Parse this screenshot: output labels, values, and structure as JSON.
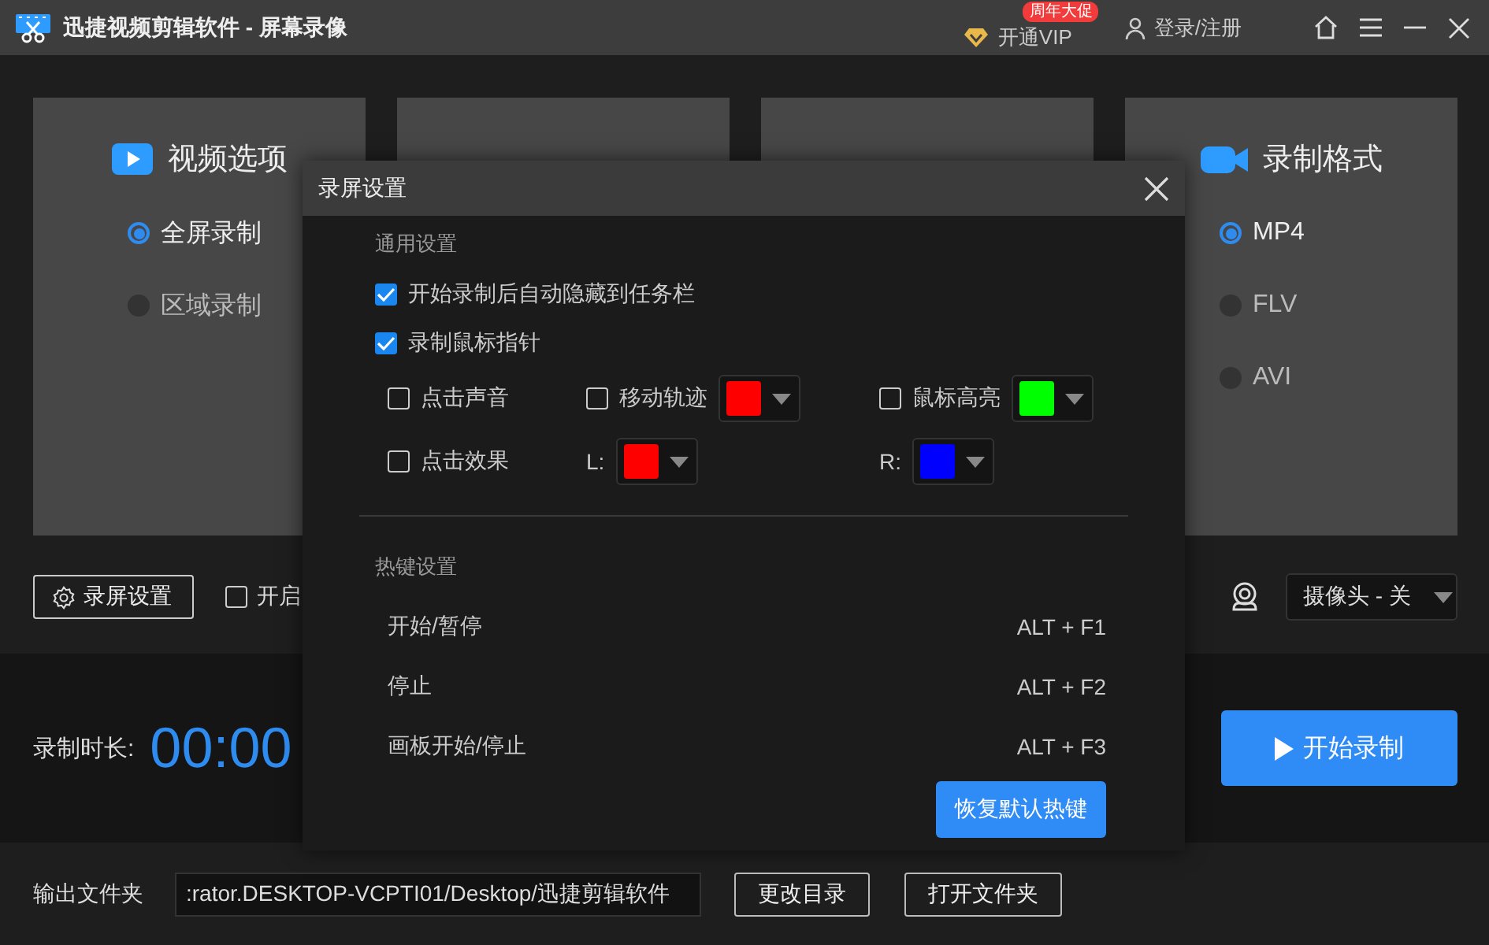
{
  "title_bar": {
    "app_name": "迅捷视频剪辑软件 - 屏幕录像",
    "vip": "开通VIP",
    "vip_badge": "周年大促",
    "login": "登录/注册"
  },
  "panels": [
    {
      "title": "视频选项",
      "options": [
        {
          "label": "全屏录制",
          "selected": true
        },
        {
          "label": "区域录制",
          "selected": false
        }
      ]
    },
    {
      "title": "录制格式",
      "options": [
        {
          "label": "MP4",
          "selected": true
        },
        {
          "label": "FLV",
          "selected": false
        },
        {
          "label": "AVI",
          "selected": false
        }
      ]
    }
  ],
  "toolbar": {
    "settings_button": "录屏设置",
    "checkbox": {
      "label": "开启",
      "checked": false
    },
    "camera_select": "摄像头 - 关"
  },
  "recording": {
    "duration_label": "录制时长:",
    "duration": "00:00",
    "start_button": "开始录制"
  },
  "output": {
    "label": "输出文件夹",
    "path": ":rator.DESKTOP-VCPTI01/Desktop/迅捷剪辑软件",
    "buttons": [
      "更改目录",
      "打开文件夹"
    ]
  },
  "dialog": {
    "title": "录屏设置",
    "general_heading": "通用设置",
    "checks": [
      {
        "label": "开始录制后自动隐藏到任务栏",
        "checked": true
      },
      {
        "label": "录制鼠标指针",
        "checked": true
      }
    ],
    "cursor_options": [
      {
        "kind": "checkbox",
        "label": "点击声音",
        "checked": false
      },
      {
        "kind": "checkbox_color",
        "label": "移动轨迹",
        "checked": false,
        "color": "#ff0000"
      },
      {
        "kind": "checkbox_color",
        "label": "鼠标高亮",
        "checked": false,
        "color": "#00ff00"
      },
      {
        "kind": "checkbox",
        "label": "点击效果",
        "checked": false
      },
      {
        "kind": "color",
        "label": "L:",
        "color": "#ff0000"
      },
      {
        "kind": "color",
        "label": "R:",
        "color": "#0000ff"
      }
    ],
    "hotkey_heading": "热键设置",
    "hotkeys": [
      {
        "action": "开始/暂停",
        "keys": "ALT + F1"
      },
      {
        "action": "停止",
        "keys": "ALT + F2"
      },
      {
        "action": "画板开始/停止",
        "keys": "ALT + F3"
      }
    ],
    "reset_button": "恢复默认热键"
  }
}
